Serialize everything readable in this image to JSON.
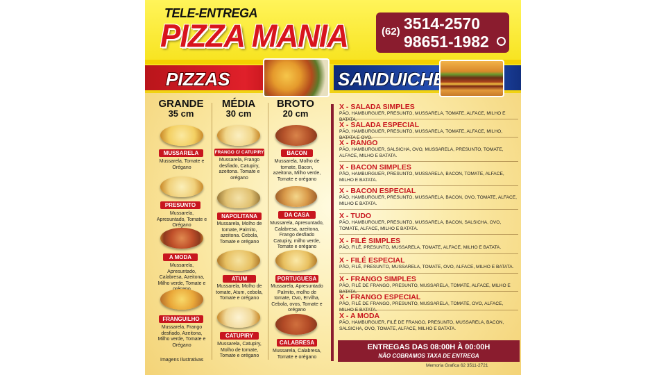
{
  "header": {
    "tele_entrega": "TELE-ENTREGA",
    "brand": "PIZZA MANIA",
    "phone_area": "(62)",
    "phone_1": "3514-2570",
    "phone_2": "98651-1982",
    "whatsapp_icon": "whatsapp-icon"
  },
  "sections": {
    "pizzas": "PIZZAS",
    "sanduiches": "SANDUICHES"
  },
  "sizes": [
    {
      "name": "GRANDE",
      "cm": "35 cm"
    },
    {
      "name": "MÉDIA",
      "cm": "30 cm"
    },
    {
      "name": "BROTO",
      "cm": "20 cm"
    }
  ],
  "pizzas": {
    "col1": [
      {
        "name": "MUSSARELA",
        "desc": "Mussarela, Tomate e Orégano"
      },
      {
        "name": "PRESUNTO",
        "desc": "Mussarela, Apresuntado, Tomate e Orégano"
      },
      {
        "name": "A MODA",
        "desc": "Mussarela, Apresuntado, Calabresa, Azeitona, Milho verde, Tomate e orégano"
      },
      {
        "name": "FRANGUILHO",
        "desc": "Mussarela, Frango desfiado, Azeitona, Milho verde, Tomate e Orégano"
      }
    ],
    "col2": [
      {
        "name": "FRANGO C/ CATUPIRY",
        "desc": "Mussarela, Frango desfiado, Catupiry, azeitona. Tomate e orégano"
      },
      {
        "name": "NAPOLITANA",
        "desc": "Mussarela, Molho de tomate, Palmito, azeitona. Cebola, Tomate e orégano"
      },
      {
        "name": "ATUM",
        "desc": "Mussarela, Molho de tomate, Atum, cebola, Tomate e orégano"
      },
      {
        "name": "CATUPIRY",
        "desc": "Mussarela, Catupiry, Molho de tomate, Tomate e orégano"
      }
    ],
    "col3": [
      {
        "name": "BACON",
        "desc": "Mussarela, Molho de tomate, Bacon, azeitona, Milho verde, Tomate e orégano"
      },
      {
        "name": "DA CASA",
        "desc": "Mussarela, Apresuntado, Calabresa, azeitona, Frango desfiado Catupiry, milho verde, Tomate e orégano"
      },
      {
        "name": "PORTUGUESA",
        "desc": "Mussarela, Apresuntado Palmito, molho de tomate, Ovo, Ervilha, Cebola, ovos, Tomate e orégano"
      },
      {
        "name": "CALABRESA",
        "desc": "Mussarela, Calabresa, Tomate e orégano"
      }
    ],
    "note": "Imagens Ilustrativas"
  },
  "sanduiches": [
    {
      "name": "X - SALADA SIMPLES",
      "desc": "PÃO, HAMBURGUER, PRESUNTO, MUSSARELA, TOMATE, ALFACE, MILHO E BATATA."
    },
    {
      "name": "X - SALADA ESPECIAL",
      "desc": "PÃO, HAMBURGUER, PRESUNTO, MUSSARELA, TOMATE, ALFACE, MILHO, BATATA E OVO."
    },
    {
      "name": "X - RANGO",
      "desc": "PÃO, HAMBURGUER, SALSICHA, OVO, MUSSARELA, PRESUNTO, TOMATE, ALFACE, MILHO E BATATA."
    },
    {
      "name": "X - BACON SIMPLES",
      "desc": "PÃO, HAMBURGUER, PRESUNTO, MUSSARELA, BACON, TOMATE, ALFACE, MILHO E BATATA."
    },
    {
      "name": "X - BACON ESPECIAL",
      "desc": "PÃO, HAMBURGUER, PRESUNTO, MUSSARELA, BACON, OVO, TOMATE, ALFACE, MILHO E BATATA."
    },
    {
      "name": "X - TUDO",
      "desc": "PÃO, HAMBURGUER, PRESUNTO, MUSSARELA, BACON, SALSICHA, OVO, TOMATE, ALFACE, MILHO E BATATA."
    },
    {
      "name": "X - FILÉ SIMPLES",
      "desc": "PÃO, FILÉ, PRESUNTO, MUSSARELA, TOMATE, ALFACE, MILHO E BATATA."
    },
    {
      "name": "X - FILÉ ESPECIAL",
      "desc": "PÃO, FILÉ, PRESUNTO, MUSSARELA, TOMATE, OVO, ALFACE, MILHO E BATATA."
    },
    {
      "name": "X - FRANGO SIMPLES",
      "desc": "PÃO, FILÉ DE FRANGO, PRESUNTO, MUSSARELA, TOMATE, ALFACE, MILHO E BATATA."
    },
    {
      "name": "X - FRANGO ESPECIAL",
      "desc": "PÃO, FILÉ DE FRANGO, PRESUNTO, MUSSARELA, TOMATE, OVO, ALFACE, MILHO E BATATA."
    },
    {
      "name": "X - A MODA",
      "desc": "PÃO, HAMBURGUER, FILÉ DE FRANGO, PRESUNTO, MUSSARELA, BACON, SALSICHA, OVO, TOMATE, ALFACE, MILHO E BATATA."
    }
  ],
  "footer": {
    "entregas": "ENTREGAS DAS 08:00H À 00:00H",
    "taxa": "NÃO COBRAMOS TAXA DE ENTREGA",
    "credit": "Memoria Grafica 62 3511-2721"
  },
  "colors": {
    "brand_red": "#d8141d",
    "phone_bg": "#8a1c2e",
    "yellow": "#f7e31e",
    "blue": "#1c3f9e"
  }
}
